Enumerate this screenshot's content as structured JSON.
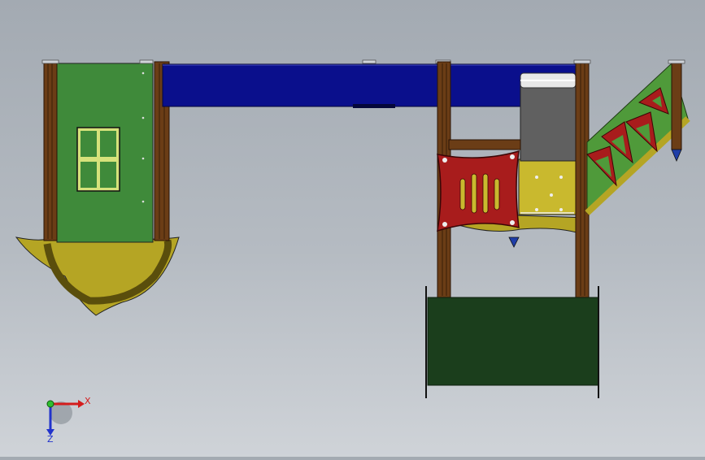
{
  "viewport": {
    "background_top": "#a3aab2",
    "background_bottom": "#cfd3d8"
  },
  "triad": {
    "x_label": "X",
    "z_label": "Z",
    "x_color": "#d41c1c",
    "y_color": "#2fbf2f",
    "z_color": "#2233cc"
  },
  "colors": {
    "wood": "#6b3d16",
    "wood_dark": "#3a1f08",
    "panel_green": "#3f8a3a",
    "roof_blue": "#0a0f8c",
    "slide_yellow": "#b5a524",
    "climber_red": "#a81c1c",
    "net_dark_green": "#1b3e1c",
    "motor_gray": "#606060",
    "ramp_green": "#4f9a3a"
  }
}
